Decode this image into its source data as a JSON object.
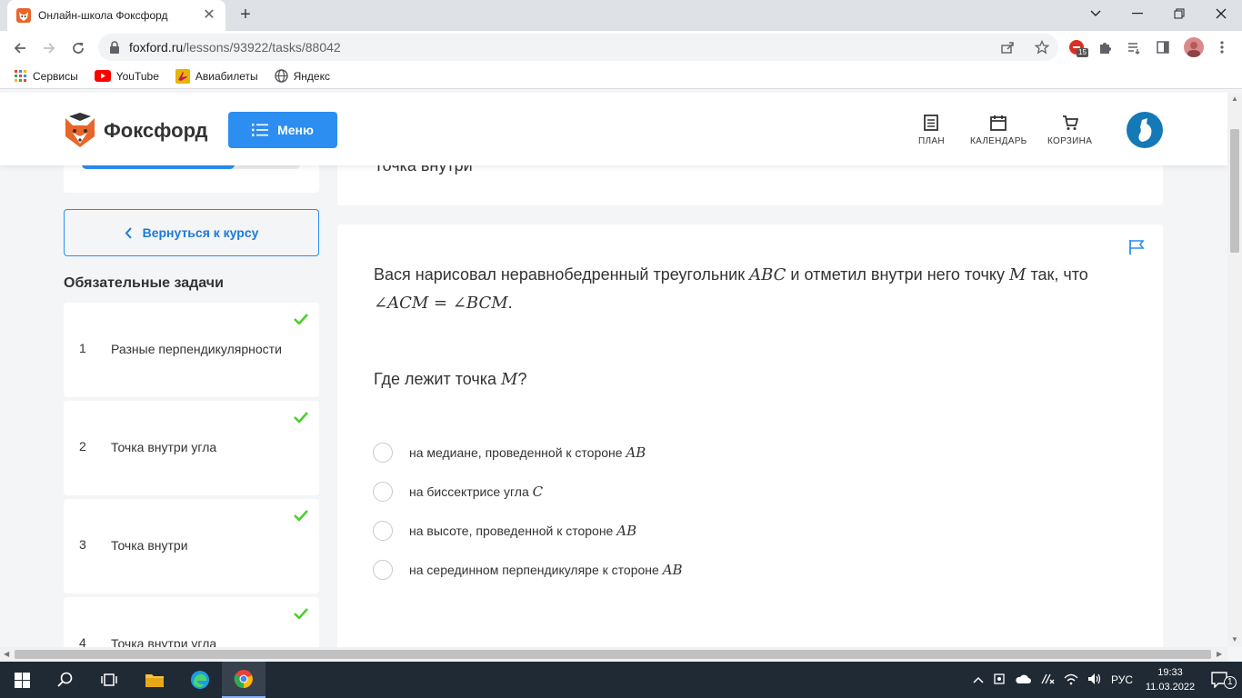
{
  "browser": {
    "tab_title": "Онлайн-школа Фоксфорд",
    "url_host": "foxford.ru",
    "url_path": "/lessons/93922/tasks/88042",
    "extension_badge": "15",
    "bookmarks": [
      {
        "label": "Сервисы",
        "icon": "apps-grid-icon"
      },
      {
        "label": "YouTube",
        "icon": "youtube-icon"
      },
      {
        "label": "Авиабилеты",
        "icon": "flight-icon"
      },
      {
        "label": "Яндекс",
        "icon": "globe-icon"
      }
    ]
  },
  "site": {
    "logo_text": "Фоксфорд",
    "menu_label": "Меню",
    "nav": [
      {
        "label": "ПЛАН",
        "icon": "plan-icon"
      },
      {
        "label": "КАЛЕНДАРЬ",
        "icon": "calendar-icon"
      },
      {
        "label": "КОРЗИНА",
        "icon": "cart-icon"
      }
    ],
    "accent": "#2b8ef0",
    "check_color": "#4ccf2f"
  },
  "sidebar": {
    "progress_fraction": 0.7,
    "back_label": "Вернуться к курсу",
    "section_title": "Обязательные задачи",
    "tasks": [
      {
        "num": "1",
        "name": "Разные перпендикулярности",
        "done": true
      },
      {
        "num": "2",
        "name": "Точка внутри угла",
        "done": true
      },
      {
        "num": "3",
        "name": "Точка внутри",
        "done": true
      },
      {
        "num": "4",
        "name": "Точка внутри угла",
        "done": true
      }
    ]
  },
  "main": {
    "title_partial": "Точка внутри",
    "statement": {
      "part1": "Вася нарисовал неравнобедренный треугольник ",
      "math1": "ABC",
      "part2": " и отметил внутри него точку ",
      "math2": "M",
      "part3": " так, что ",
      "math3": "∠ACM = ∠BCM",
      "part4": "."
    },
    "question": {
      "text": "Где лежит точка ",
      "math": "M",
      "end": "?"
    },
    "options": [
      {
        "text": "на медиане, проведенной к стороне ",
        "math": "AB"
      },
      {
        "text": "на биссектрисе угла ",
        "math": "C"
      },
      {
        "text": "на высоте, проведенной к стороне ",
        "math": "AB"
      },
      {
        "text": "на серединном перпендикуляре к стороне ",
        "math": "AB"
      }
    ]
  },
  "taskbar": {
    "lang": "РУС",
    "time": "19:33",
    "date": "11.03.2022",
    "notifications": "1"
  }
}
